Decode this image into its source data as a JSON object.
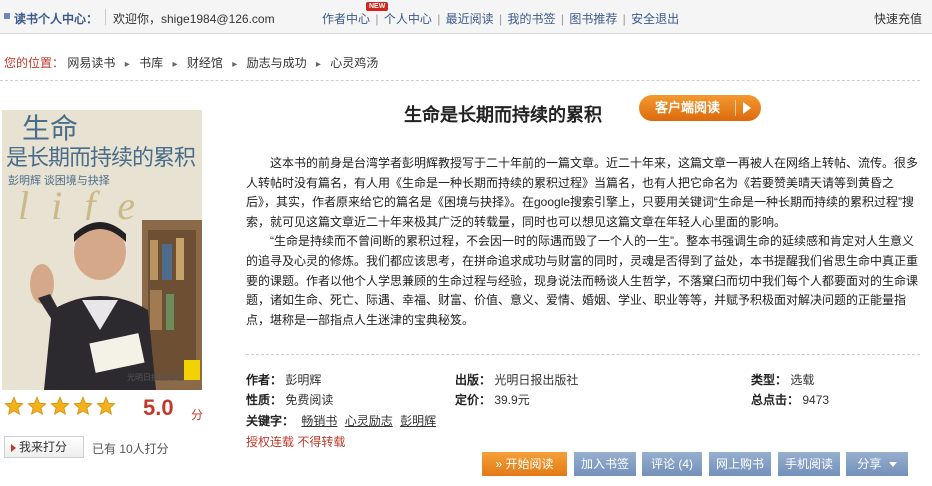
{
  "topbar": {
    "title": "读书个人中心：",
    "welcome": "欢迎你，shige1984@126.com",
    "nav": {
      "author": "作者中心",
      "new_badge": "NEW",
      "personal": "个人中心",
      "recent": "最近阅读",
      "bookshelf": "我的书签",
      "recommend": "图书推荐",
      "logout": "安全退出"
    },
    "recharge": "快速充值"
  },
  "breadcrumb": {
    "label": "您的位置：",
    "items": [
      "网易读书",
      "书库",
      "财经馆",
      "励志与成功",
      "心灵鸡汤"
    ]
  },
  "book": {
    "title": "生命是长期而持续的累积",
    "client_button": "客户端阅读",
    "cover": {
      "title_line1": "生命",
      "title_line2": "是长期而持续的累积",
      "subtitle": "彭明辉 谈困境与抉择",
      "word": "life",
      "publisher": "光明日报出版社"
    },
    "description": [
      "这本书的前身是台湾学者彭明辉教授写于二十年前的一篇文章。近二十年来，这篇文章一再被人在网络上转帖、流传。很多人转帖时没有篇名，有人用《生命是一种长期而持续的累积过程》当篇名，也有人把它命名为《若要赞美晴天请等到黄昏之后》，其实，作者原来给它的篇名是《困境与抉择》。在google搜索引擎上，只要用关键词“生命是一种长期而持续的累积过程”搜索，就可见这篇文章近二十年来极其广泛的转载量，同时也可以想见这篇文章在年轻人心里面的影响。",
      "“生命是持续而不曾间断的累积过程，不会因一时的际遇而毁了一个人的一生”。整本书强调生命的延续感和肯定对人生意义的追寻及心灵的修炼。我们都应该思考，在拼命追求成功与财富的同时，灵魂是否得到了益处，本书提醒我们省思生命中真正重要的课题。作者以他个人学思兼顾的生命过程与经验，现身说法而畅谈人生哲学，不落窠臼而切中我们每个人都要面对的生命课题，诸如生命、死亡、际遇、幸福、财富、价值、意义、爱情、婚姻、学业、职业等等，并赋予积极面对解决问题的正能量指点，堪称是一部指点人生迷津的宝典秘笈。"
    ],
    "meta": {
      "author_label": "作者：",
      "author": "彭明辉",
      "publisher_label": "出版：",
      "publisher": "光明日报出版社",
      "category_label": "类型：",
      "category": "选载",
      "nature_label": "性质：",
      "nature": "免费阅读",
      "price_label": "定价：",
      "price": "39.9元",
      "clicks_label": "总点击：",
      "clicks": "9473",
      "keywords_label": "关键字：",
      "keywords": [
        "畅销书",
        "心灵励志",
        "彭明辉"
      ],
      "license": "授权连载  不得转载"
    }
  },
  "rating": {
    "stars": 5,
    "score": "5.0",
    "unit": "分",
    "rate_button": "我来打分",
    "rated_text": "已有  10人打分"
  },
  "actions": {
    "start_reading": "开始阅读",
    "add_bookmark": "加入书签",
    "comments": "评论 (4)",
    "buy_online": "网上购书",
    "mobile_reading": "手机阅读",
    "share": "分享"
  },
  "colors": {
    "accent_red": "#c0392b",
    "orange": "#e27a16",
    "button_blue": "#7390ba",
    "link_blue": "#3b5a8c"
  }
}
